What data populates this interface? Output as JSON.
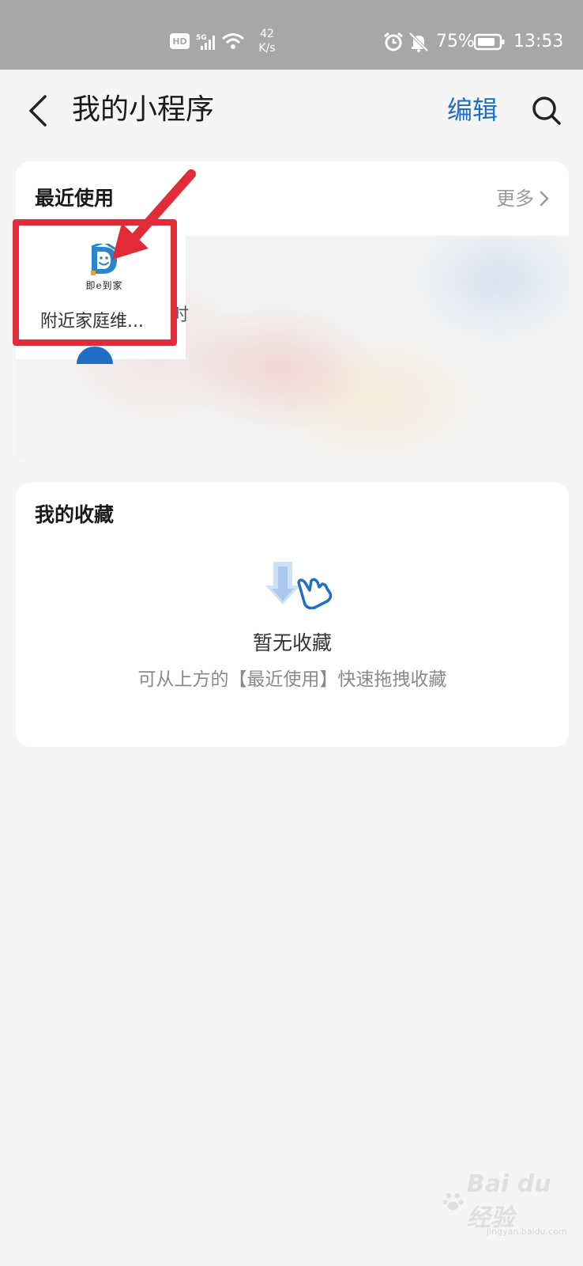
{
  "status_bar": {
    "hd_badge": "HD",
    "network": "5G",
    "net_speed_value": "42",
    "net_speed_unit": "K/s",
    "battery": "75%",
    "time": "13:53"
  },
  "header": {
    "title": "我的小程序",
    "edit_label": "编辑",
    "back_icon": "chevron-left-icon",
    "search_icon": "search-icon"
  },
  "recent": {
    "title": "最近使用",
    "more_label": "更多",
    "apps": [
      {
        "name": "附近家庭维...",
        "logo_text": "即e到家",
        "logo_letter": "D"
      }
    ],
    "peek_text": "时"
  },
  "favorites": {
    "title": "我的收藏",
    "empty_title": "暂无收藏",
    "empty_desc": "可从上方的【最近使用】快速拖拽收藏"
  },
  "watermark": {
    "text": "Bai du 经验",
    "sub": "jingyan.baidu.com"
  },
  "colors": {
    "accent": "#1f6fc4",
    "highlight": "#e12b38",
    "status_bar_bg": "#a7a7a7",
    "page_bg": "#f5f5f5"
  }
}
